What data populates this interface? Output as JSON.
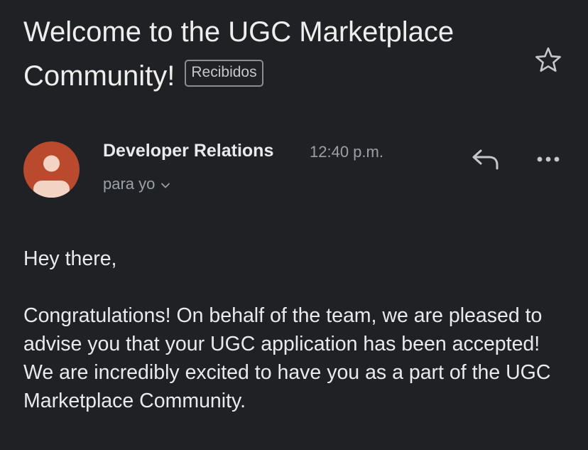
{
  "email": {
    "subject_line1": "Welcome to the UGC Marketplace",
    "subject_line2": "Community!",
    "label": "Recibidos",
    "sender": "Developer Relations",
    "time": "12:40 p.m.",
    "recipient": "para yo",
    "greeting": "Hey there,",
    "paragraph": "Congratulations! On behalf of the team, we are pleased to advise you that your UGC application has been accepted! We are incredibly excited to have you as a part of the UGC Marketplace Community."
  },
  "icons": {
    "star": "star-icon",
    "reply": "reply-icon",
    "more": "more-icon",
    "avatar": "avatar-icon",
    "chevron": "chevron-down-icon"
  },
  "colors": {
    "background": "#202124",
    "avatar": "#b94a2e",
    "muted_text": "#9aa0a6"
  }
}
